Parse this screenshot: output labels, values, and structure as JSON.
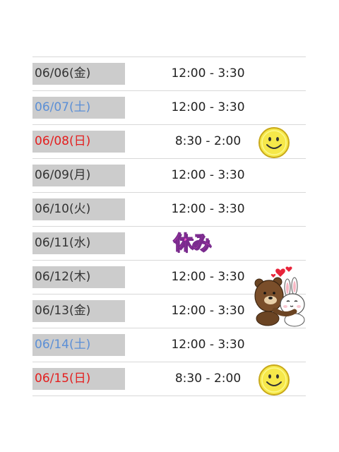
{
  "rows": [
    {
      "date": "06/06(金)",
      "time": "12:00 - 3:30"
    },
    {
      "date": "06/07(土)",
      "time": "12:00 - 3:30"
    },
    {
      "date": "06/08(日)",
      "time": "8:30 - 2:00"
    },
    {
      "date": "06/09(月)",
      "time": "12:00 - 3:30"
    },
    {
      "date": "06/10(火)",
      "time": "12:00 - 3:30"
    },
    {
      "date": "06/11(水)",
      "holiday": "休み"
    },
    {
      "date": "06/12(木)",
      "time": "12:00 - 3:30"
    },
    {
      "date": "06/13(金)",
      "time": "12:00 - 3:30"
    },
    {
      "date": "06/14(土)",
      "time": "12:00 - 3:30"
    },
    {
      "date": "06/15(日)",
      "time": "8:30 - 2:00"
    }
  ],
  "colors": {
    "weekday": "#333333",
    "saturday": "#5b8fd6",
    "sunday": "#e41e1e",
    "date_bg": "#cccccc",
    "holiday_text": "#ff4fd2"
  },
  "icons": [
    "smiley-face-icon",
    "brown-bear-and-cony-sticker-icon"
  ]
}
